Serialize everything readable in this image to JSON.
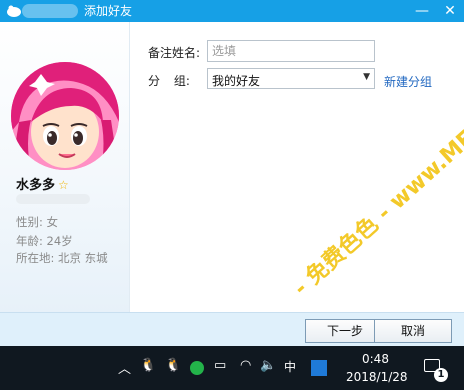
{
  "window": {
    "title": "添加好友",
    "controls": {
      "minimize_icon": "minimize-icon",
      "close_icon": "close-icon"
    },
    "accent_color": "#16a0e6"
  },
  "profile": {
    "nickname": "水多多",
    "gender": "性别: 女",
    "age": "年龄: 24岁",
    "location": "所在地: 北京  东城"
  },
  "form": {
    "remark_label": "备注姓名:",
    "remark_placeholder": "选填",
    "remark_value": "",
    "group_label": "分 组:",
    "group_selected": "我的好友",
    "new_group_link": "新建分组"
  },
  "buttons": {
    "next": "下一步",
    "cancel": "取消"
  },
  "taskbar": {
    "ime": "中",
    "time": "0:48",
    "date": "2018/1/28",
    "notification_count": "1"
  },
  "watermark": "- 免费色色 - www.MFsese.com"
}
